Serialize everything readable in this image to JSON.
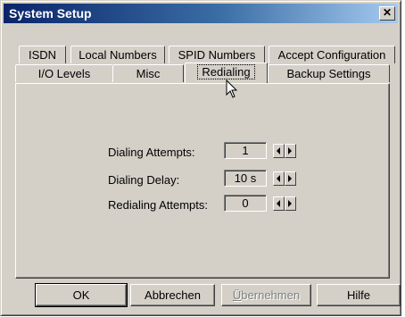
{
  "window": {
    "title": "System Setup",
    "close_glyph": "✕"
  },
  "tabs_row1": [
    {
      "label": "ISDN"
    },
    {
      "label": "Local Numbers"
    },
    {
      "label": "SPID Numbers"
    },
    {
      "label": "Accept Configuration"
    }
  ],
  "tabs_row2": [
    {
      "label": "I/O Levels"
    },
    {
      "label": "Misc"
    },
    {
      "label": "Redialing",
      "active": true
    },
    {
      "label": "Backup Settings"
    }
  ],
  "settings": [
    {
      "label": "Dialing Attempts:",
      "value": "1"
    },
    {
      "label": "Dialing Delay:",
      "value": "10 s"
    },
    {
      "label": "Redialing Attempts:",
      "value": "0"
    }
  ],
  "buttons": {
    "ok": "OK",
    "cancel": "Abbrechen",
    "apply_first": "Ü",
    "apply_rest": "bernehmen",
    "help": "Hilfe"
  },
  "icons": [
    "close-icon",
    "spin-left-icon",
    "spin-right-icon",
    "mouse-pointer-icon"
  ]
}
